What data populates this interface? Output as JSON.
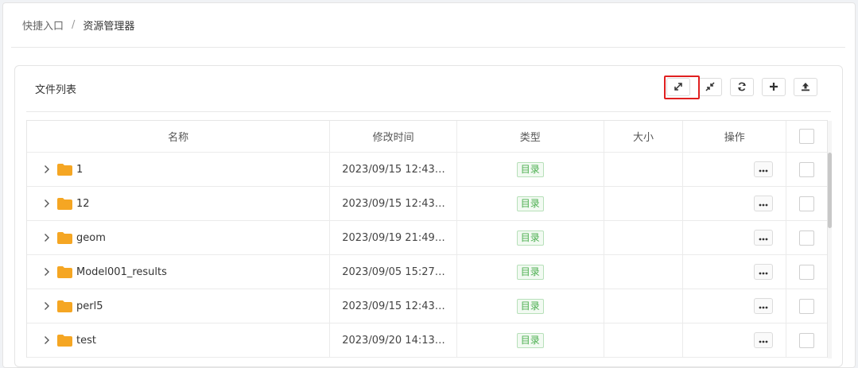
{
  "breadcrumb": {
    "items": [
      "快捷入口",
      "资源管理器"
    ],
    "separator": "/"
  },
  "panel": {
    "title": "文件列表"
  },
  "toolbar": {
    "buttons": [
      {
        "name": "expand-button",
        "icon": "expand-icon"
      },
      {
        "name": "collapse-button",
        "icon": "compress-icon"
      },
      {
        "name": "refresh-button",
        "icon": "refresh-icon"
      },
      {
        "name": "add-button",
        "icon": "plus-icon"
      },
      {
        "name": "upload-button",
        "icon": "upload-icon"
      }
    ]
  },
  "table": {
    "headers": {
      "name": "名称",
      "modified": "修改时间",
      "type": "类型",
      "size": "大小",
      "actions": "操作"
    },
    "rows": [
      {
        "name": "1",
        "modified": "2023/09/15 12:43:…",
        "type": "目录",
        "size": ""
      },
      {
        "name": "12",
        "modified": "2023/09/15 12:43:…",
        "type": "目录",
        "size": ""
      },
      {
        "name": "geom",
        "modified": "2023/09/19 21:49:…",
        "type": "目录",
        "size": ""
      },
      {
        "name": "Model001_results",
        "modified": "2023/09/05 15:27:…",
        "type": "目录",
        "size": ""
      },
      {
        "name": "perl5",
        "modified": "2023/09/15 12:43:…",
        "type": "目录",
        "size": ""
      },
      {
        "name": "test",
        "modified": "2023/09/20 14:13:…",
        "type": "目录",
        "size": ""
      }
    ]
  },
  "colors": {
    "folder": "#f5a623",
    "tag_text": "#4caf50",
    "highlight": "#e02020"
  }
}
